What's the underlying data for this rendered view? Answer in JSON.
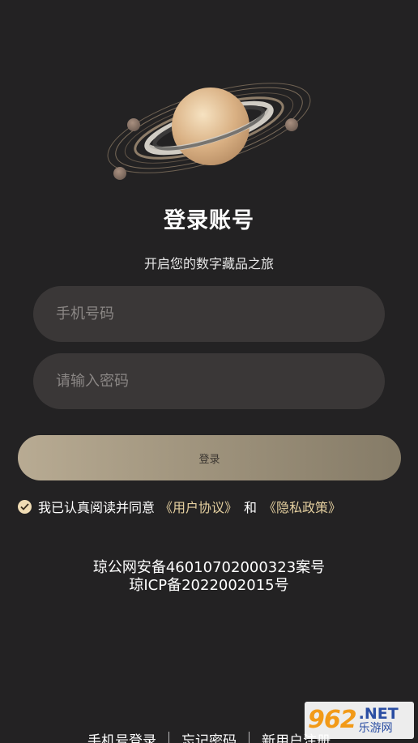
{
  "header": {
    "title": "登录账号",
    "subtitle": "开启您的数字藏品之旅"
  },
  "form": {
    "phone_placeholder": "手机号码",
    "password_placeholder": "请输入密码",
    "login_label": "登录"
  },
  "agreement": {
    "prefix": "我已认真阅读并同意",
    "user_agreement": "《用户协议》",
    "and": "和",
    "privacy_policy": "《隐私政策》",
    "checked": true
  },
  "footer": {
    "icp_line1": "琼公网安备46010702000323案号",
    "icp_line2": "琼ICP备2022002015号"
  },
  "bottom_nav": {
    "phone_login": "手机号登录",
    "forgot_password": "忘记密码",
    "register": "新用户注册"
  },
  "watermark": {
    "logo": "962",
    "domain": ".NET",
    "name": "乐游网"
  },
  "colors": {
    "background": "#232223",
    "field": "#3a3737",
    "accent": "#e4cf9f"
  }
}
